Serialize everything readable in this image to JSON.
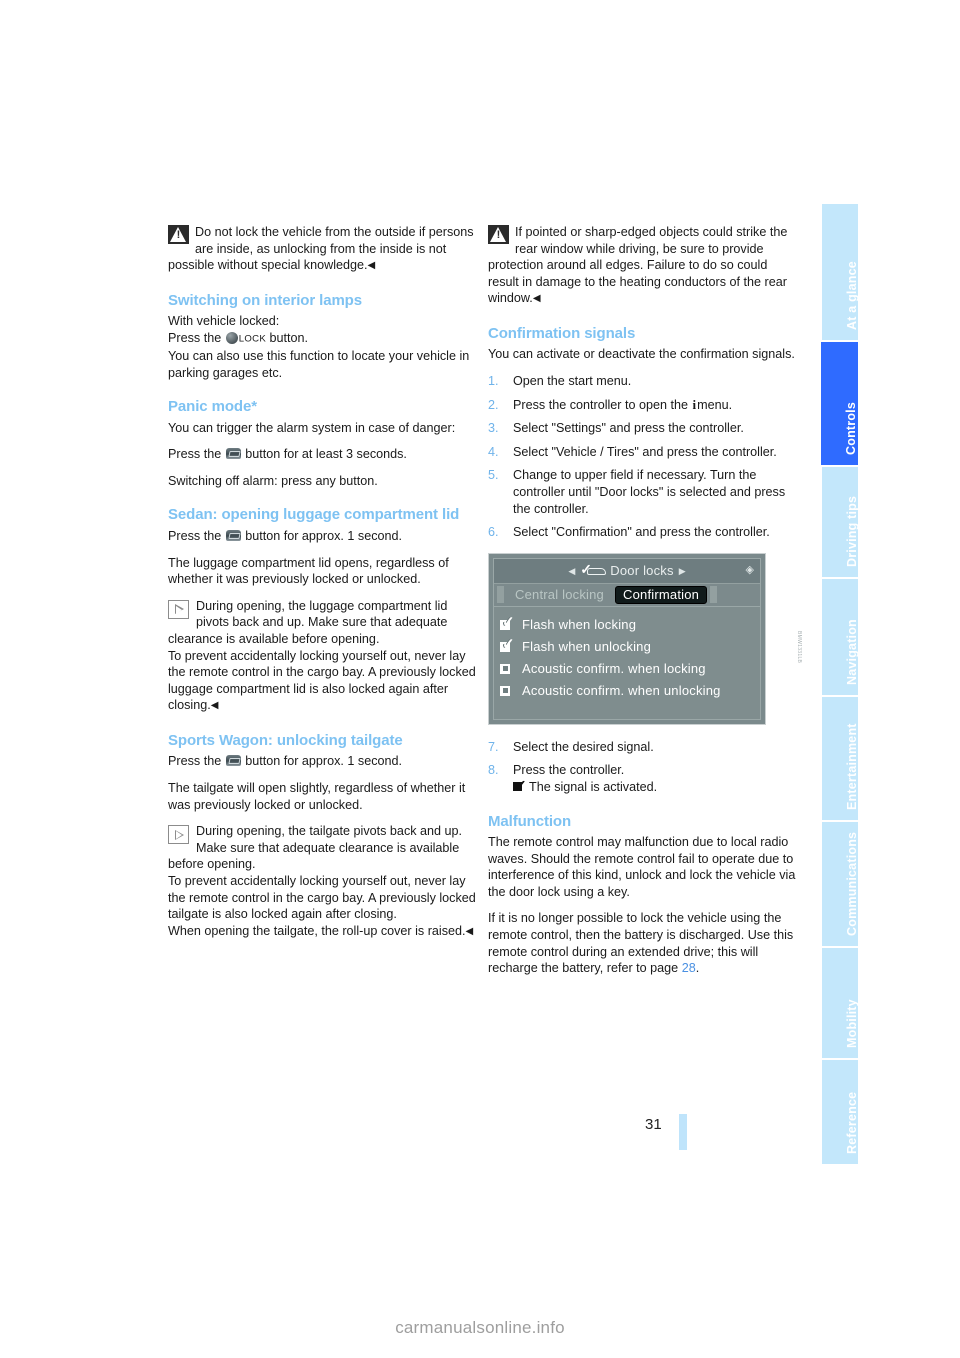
{
  "document": {
    "page_number": "31",
    "watermark": "carmanualsonline.info"
  },
  "sidebar": {
    "tabs": [
      {
        "label": "At a glance",
        "active": false
      },
      {
        "label": "Controls",
        "active": true
      },
      {
        "label": "Driving tips",
        "active": false
      },
      {
        "label": "Navigation",
        "active": false
      },
      {
        "label": "Entertainment",
        "active": false
      },
      {
        "label": "Communications",
        "active": false
      },
      {
        "label": "Mobility",
        "active": false
      },
      {
        "label": "Reference",
        "active": false
      }
    ],
    "active_color": "#2f6bff",
    "inactive_color": "#c3e7fb"
  },
  "left_column": {
    "warning": {
      "icon": "warning-triangle-icon",
      "text": "Do not lock the vehicle from the outside if persons are inside, as unlocking from the inside is not possible without special knowledge."
    },
    "section_interior_lamps": {
      "heading": "Switching on interior lamps",
      "p1": "With vehicle locked:",
      "p2_before": "Press the",
      "p2_lock_label": "LOCK",
      "p2_after": "button.",
      "p3": "You can also use this function to locate your vehicle in parking garages etc."
    },
    "section_panic": {
      "heading": "Panic mode*",
      "p1": "You can trigger the alarm system in case of danger:",
      "p2_before": "Press the",
      "p2_after": "button for at least 3 seconds.",
      "p3": "Switching off alarm: press any button."
    },
    "section_sedan": {
      "heading": "Sedan: opening luggage compartment lid",
      "p1_before": "Press the",
      "p1_after": "button for approx. 1 second.",
      "p2": "The luggage compartment lid opens, regardless of whether it was previously locked or unlocked.",
      "tip": "During opening, the luggage compartment lid pivots back and up. Make sure that adequate clearance is available before opening.",
      "p3": "To prevent accidentally locking yourself out, never lay the remote control in the cargo bay. A previously locked luggage compartment lid is also locked again after closing."
    },
    "section_wagon": {
      "heading": "Sports Wagon: unlocking tailgate",
      "p1_before": "Press the",
      "p1_after": "button for approx. 1 second.",
      "p2": "The tailgate will open slightly, regardless of whether it was previously locked or unlocked.",
      "tip": "During opening, the tailgate pivots back and up. Make sure that adequate clearance is available before opening.",
      "p3": "To prevent accidentally locking yourself out, never lay the remote control in the cargo bay. A previously locked tailgate is also locked again after closing.",
      "p4": "When opening the tailgate, the roll-up cover is raised."
    }
  },
  "right_column": {
    "warning": {
      "icon": "warning-triangle-icon",
      "text": "If pointed or sharp-edged objects could strike the rear window while driving, be sure to provide protection around all edges. Failure to do so could result in damage to the heating conductors of the rear window."
    },
    "section_confirmation": {
      "heading": "Confirmation signals",
      "intro": "You can activate or deactivate the confirmation signals.",
      "steps": [
        {
          "num": "1.",
          "text": "Open the start menu."
        },
        {
          "num": "2.",
          "text_before": "Press the controller to open the",
          "info_glyph": "i",
          "text_after": "menu."
        },
        {
          "num": "3.",
          "text": "Select \"Settings\" and press the controller."
        },
        {
          "num": "4.",
          "text": "Select \"Vehicle / Tires\" and press the controller."
        },
        {
          "num": "5.",
          "text": "Change to upper field if necessary. Turn the controller until \"Door locks\" is selected and press the controller."
        },
        {
          "num": "6.",
          "text": "Select \"Confirmation\" and press the controller."
        }
      ],
      "steps_after": [
        {
          "num": "7.",
          "text": "Select the desired signal."
        },
        {
          "num": "8.",
          "text": "Press the controller."
        }
      ],
      "step8_result": "The signal is activated."
    },
    "idrive_screenshot": {
      "title": "Door locks",
      "tabs": [
        {
          "label": "Central locking",
          "selected": false
        },
        {
          "label": "Confirmation",
          "selected": true
        }
      ],
      "options": [
        {
          "label": "Flash when locking",
          "checked": true
        },
        {
          "label": "Flash when unlocking",
          "checked": true
        },
        {
          "label": "Acoustic confirm. when locking",
          "checked": false
        },
        {
          "label": "Acoustic confirm. when unlocking",
          "checked": false
        }
      ]
    },
    "section_malfunction": {
      "heading": "Malfunction",
      "p1": "The remote control may malfunction due to local radio waves. Should the remote control fail to operate due to interference of this kind, unlock and lock the vehicle via the door lock using a key.",
      "p2_before": "If it is no longer possible to lock the vehicle using the remote control, then the battery is discharged. Use this remote control during an extended drive; this will recharge the battery, refer to page",
      "p2_ref": "28",
      "p2_after": "."
    }
  }
}
